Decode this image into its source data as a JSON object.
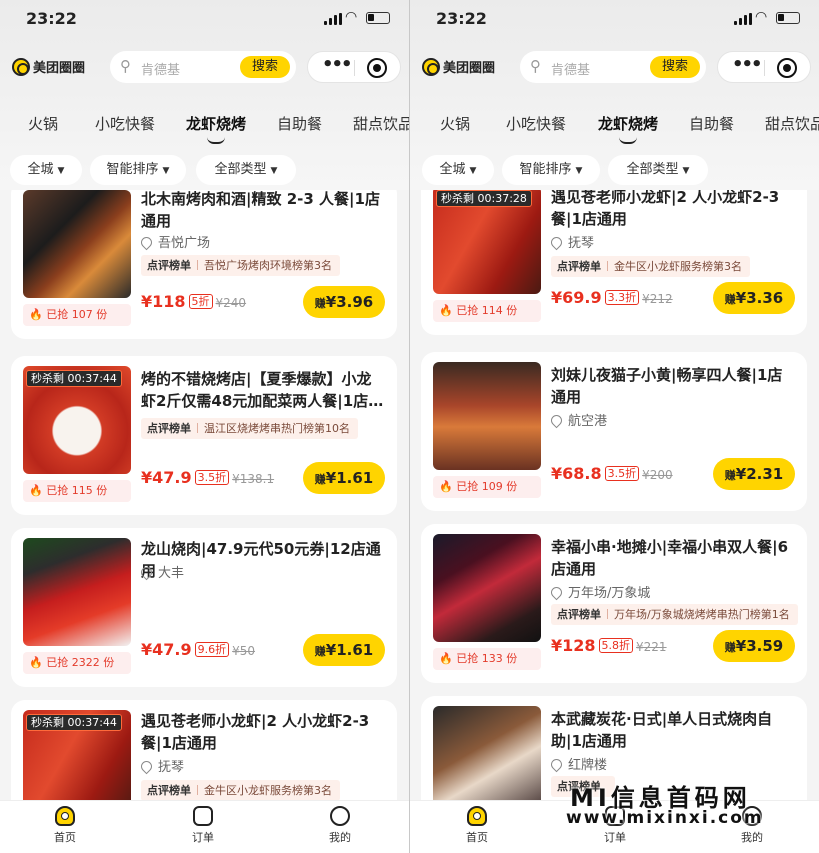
{
  "status": {
    "time": "23:22"
  },
  "header": {
    "logo_text": "美团圈圈",
    "search_placeholder": "肯德基",
    "search_button": "搜索"
  },
  "categories": [
    "火锅",
    "小吃快餐",
    "龙虾烧烤",
    "自助餐",
    "甜点饮品"
  ],
  "active_category": "龙虾烧烤",
  "filters": [
    "全城",
    "智能排序",
    "全部类型"
  ],
  "left_screen": {
    "cards": [
      {
        "title": "北木南烤肉和酒|精致 2-3 人餐|1店通用",
        "location": "吾悦广场",
        "rank_tag": "点评榜单",
        "rank_text": "吾悦广场烤肉环境榜第3名",
        "sold": "已抢 107 份",
        "price": "¥118",
        "discount": "5折",
        "original": "¥240",
        "earn_prefix": "赚",
        "earn": "¥3.96",
        "flash": ""
      },
      {
        "title": "烤的不错烧烤店|【夏季爆款】小龙虾2斤仅需48元加配菜两人餐|1店…",
        "location": "",
        "rank_tag": "点评榜单",
        "rank_text": "温江区烧烤烤串热门榜第10名",
        "sold": "已抢 115 份",
        "price": "¥47.9",
        "discount": "3.5折",
        "original": "¥138.1",
        "earn_prefix": "赚",
        "earn": "¥1.61",
        "flash": "秒杀剩 00:37:44"
      },
      {
        "title": "龙山烧肉|47.9元代50元券|12店通用",
        "location": "大丰",
        "rank_tag": "",
        "rank_text": "",
        "sold": "已抢 2322 份",
        "price": "¥47.9",
        "discount": "9.6折",
        "original": "¥50",
        "earn_prefix": "赚",
        "earn": "¥1.61",
        "flash": ""
      },
      {
        "title": "遇见苍老师小龙虾|2 人小龙虾2-3餐|1店通用",
        "location": "抚琴",
        "rank_tag": "点评榜单",
        "rank_text": "金牛区小龙虾服务榜第3名",
        "sold": "",
        "price": "",
        "discount": "",
        "original": "",
        "earn_prefix": "",
        "earn": "",
        "flash": "秒杀剩 00:37:44"
      }
    ]
  },
  "right_screen": {
    "cards": [
      {
        "title": "遇见苍老师小龙虾|2 人小龙虾2-3餐|1店通用",
        "location": "抚琴",
        "rank_tag": "点评榜单",
        "rank_text": "金牛区小龙虾服务榜第3名",
        "sold": "已抢 114 份",
        "price": "¥69.9",
        "discount": "3.3折",
        "original": "¥212",
        "earn_prefix": "赚",
        "earn": "¥3.36",
        "flash": "秒杀剩 00:37:28"
      },
      {
        "title": "刘妹儿夜猫子小黄|畅享四人餐|1店通用",
        "location": "航空港",
        "rank_tag": "",
        "rank_text": "",
        "sold": "已抢 109 份",
        "price": "¥68.8",
        "discount": "3.5折",
        "original": "¥200",
        "earn_prefix": "赚",
        "earn": "¥2.31",
        "flash": ""
      },
      {
        "title": "幸福小串·地摊小|幸福小串双人餐|6店通用",
        "location": "万年场/万象城",
        "rank_tag": "点评榜单",
        "rank_text": "万年场/万象城烧烤烤串热门榜第1名",
        "sold": "已抢 133 份",
        "price": "¥128",
        "discount": "5.8折",
        "original": "¥221",
        "earn_prefix": "赚",
        "earn": "¥3.59",
        "flash": ""
      },
      {
        "title": "本武藏炭花·日式|单人日式烧肉自助|1店通用",
        "location": "红牌楼",
        "rank_tag": "点评榜单",
        "rank_text": "",
        "sold": "",
        "price": "",
        "discount": "",
        "original": "",
        "earn_prefix": "",
        "earn": "",
        "flash": ""
      }
    ]
  },
  "tabbar": [
    "首页",
    "订单",
    "我的"
  ],
  "watermark": {
    "line1": "MI信息首码网",
    "line2": "www.mixinxi.com"
  }
}
